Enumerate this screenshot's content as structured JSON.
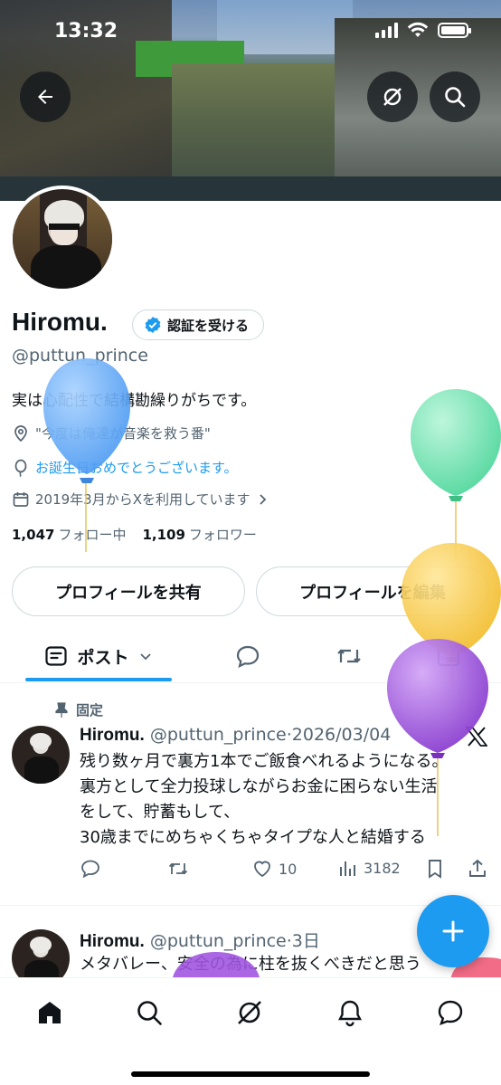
{
  "status_bar": {
    "time": "13:32"
  },
  "profile": {
    "name": "Hiromu.",
    "verify_label": "認証を受ける",
    "handle": "@puttun_prince",
    "bio": "実は心配性で結構勘繰りがちです。",
    "location": "\"今度は俺達が音楽を救う番\"",
    "birthday": "お誕生日おめでとうございます。",
    "joined": "2019年3月からXを利用しています",
    "following_count": "1,047",
    "following_label": "フォロー中",
    "followers_count": "1,109",
    "followers_label": "フォロワー",
    "share_button": "プロフィールを共有",
    "edit_button": "プロフィールを編集"
  },
  "tabs": {
    "posts_label": "ポスト"
  },
  "posts": [
    {
      "pinned_label": "固定",
      "name": "Hiromu.",
      "handle": "@puttun_prince",
      "sep": "·",
      "date": "2026/03/04",
      "lines": [
        "残り数ヶ月で裏方1本でご飯食べれるようになる。",
        "裏方として全力投球しながらお金に困らない生活",
        "をして、貯蓄もして、",
        "30歳までにめちゃくちゃタイプな人と結婚する"
      ],
      "likes": "10",
      "views": "3182"
    },
    {
      "name": "Hiromu.",
      "handle": "@puttun_prince",
      "sep": "·",
      "date": "3日",
      "lines": [
        "メタバレー、安全の為に柱を抜くべきだと思う"
      ]
    }
  ],
  "colors": {
    "accent": "#1d9bf0",
    "text": "#0f1419",
    "muted": "#536471",
    "balloon_blue": "#5aa6f5",
    "balloon_green": "#5fe0a8",
    "balloon_yellow": "#f6c744",
    "balloon_purple": "#9b4fd8"
  }
}
